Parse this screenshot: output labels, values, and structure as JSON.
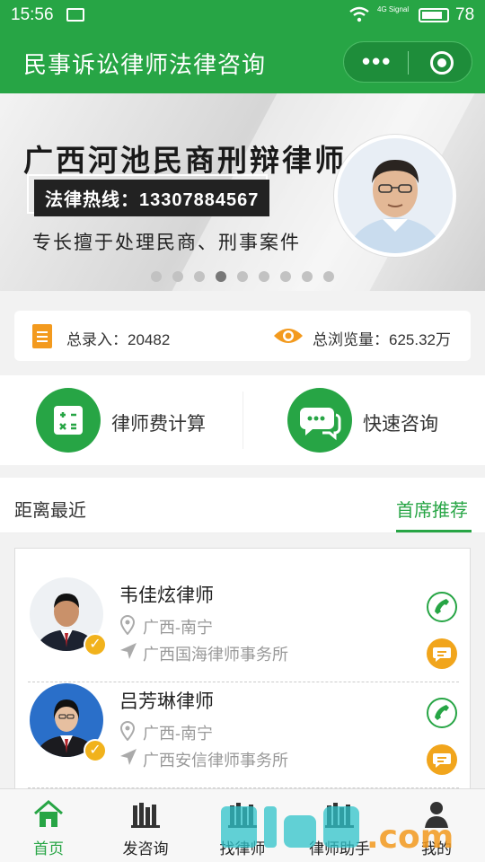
{
  "status_bar": {
    "time": "15:56",
    "network": "4G Signal",
    "battery": "78"
  },
  "header": {
    "title": "民事诉讼律师法律咨询",
    "more_label": "•••"
  },
  "banner": {
    "title": "广西河池民商刑辩律师",
    "hotline": "法律热线：13307884567",
    "description": "专长擅于处理民商、刑事案件",
    "slide_count": 9,
    "active_slide": 4
  },
  "stats": {
    "total_entries": "总录入：20482",
    "total_views": "总浏览量：625.32万"
  },
  "quick_actions": [
    {
      "label": "律师费计算",
      "icon": "calculator-icon"
    },
    {
      "label": "快速咨询",
      "icon": "chat-bubbles-icon"
    }
  ],
  "tabs": {
    "nearest": "距离最近",
    "featured": "首席推荐"
  },
  "lawyers": [
    {
      "name": "韦佳炫律师",
      "location": "广西-南宁",
      "firm": "广西国海律师事务所"
    },
    {
      "name": "吕芳琳律师",
      "location": "广西-南宁",
      "firm": "广西安信律师事务所"
    }
  ],
  "bottom_nav": [
    {
      "label": "首页",
      "icon": "home-icon",
      "active": true
    },
    {
      "label": "发咨询",
      "icon": "books-icon",
      "active": false
    },
    {
      "label": "找律师",
      "icon": "books-icon",
      "active": false
    },
    {
      "label": "律师助手",
      "icon": "books-icon",
      "active": false
    },
    {
      "label": "我的",
      "icon": "user-icon",
      "active": false
    }
  ],
  "colors": {
    "primary": "#27a545",
    "accent": "#f1a51c"
  }
}
